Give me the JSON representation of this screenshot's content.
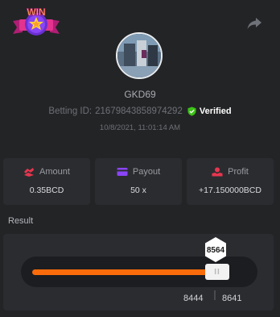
{
  "badge": {
    "text": "WIN"
  },
  "user": {
    "name": "GKD69"
  },
  "bet": {
    "betting_id_label": "Betting ID:",
    "betting_id": "21679843858974292",
    "verified": "Verified",
    "datetime": "10/8/2021, 11:01:14 AM"
  },
  "stats": {
    "amount": {
      "label": "Amount",
      "value": "0.35BCD"
    },
    "payout": {
      "label": "Payout",
      "value": "50 x"
    },
    "profit": {
      "label": "Profit",
      "value": "+17.150000BCD"
    }
  },
  "result": {
    "label": "Result",
    "value": "8564",
    "range_low": "8444",
    "range_high": "8641",
    "handle_grip": "II",
    "fill_fraction": 0.83
  },
  "colors": {
    "accent_orange": "#f96b0b",
    "verified_green": "#3bc117",
    "amount_icon": "#e8364f",
    "payout_icon": "#8a45f6",
    "profit_icon": "#e8364f"
  }
}
